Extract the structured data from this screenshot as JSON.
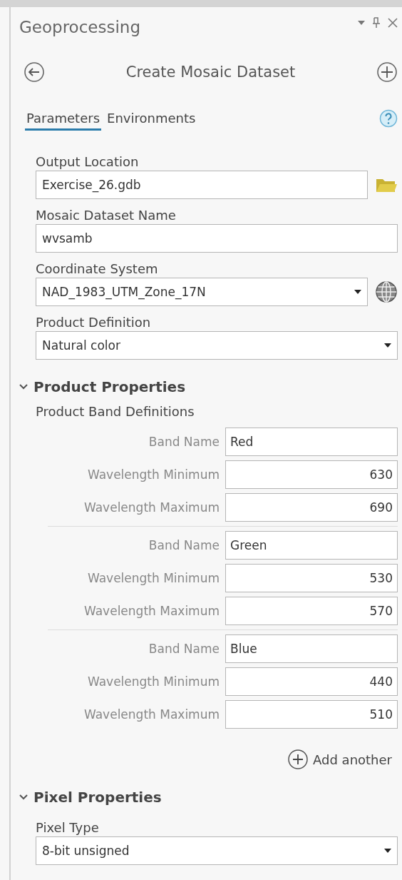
{
  "panel": {
    "title": "Geoprocessing"
  },
  "tool": {
    "title": "Create Mosaic Dataset"
  },
  "tabs": [
    {
      "label": "Parameters",
      "selected": true
    },
    {
      "label": "Environments",
      "selected": false
    }
  ],
  "parameters": [
    {
      "kind": "folder",
      "label": "Output Location",
      "value": "Exercise_26.gdb"
    },
    {
      "kind": "text",
      "label": "Mosaic Dataset Name",
      "value": "wvsamb"
    },
    {
      "kind": "dropdown-globe",
      "label": "Coordinate System",
      "value": "NAD_1983_UTM_Zone_17N"
    },
    {
      "kind": "dropdown",
      "label": "Product Definition",
      "value": "Natural color"
    }
  ],
  "sections": [
    {
      "title": "Product Properties",
      "expanded": true,
      "subheading": "Product Band Definitions",
      "bands": [
        {
          "name_label": "Band Name",
          "name": "Red",
          "min_label": "Wavelength Minimum",
          "min": "630",
          "max_label": "Wavelength Maximum",
          "max": "690"
        },
        {
          "name_label": "Band Name",
          "name": "Green",
          "min_label": "Wavelength Minimum",
          "min": "530",
          "max_label": "Wavelength Maximum",
          "max": "570"
        },
        {
          "name_label": "Band Name",
          "name": "Blue",
          "min_label": "Wavelength Minimum",
          "min": "440",
          "max_label": "Wavelength Maximum",
          "max": "510"
        }
      ],
      "add_label": "Add another"
    },
    {
      "title": "Pixel Properties",
      "expanded": true,
      "parameters": [
        {
          "kind": "dropdown",
          "label": "Pixel Type",
          "value": "8-bit unsigned"
        }
      ]
    }
  ]
}
